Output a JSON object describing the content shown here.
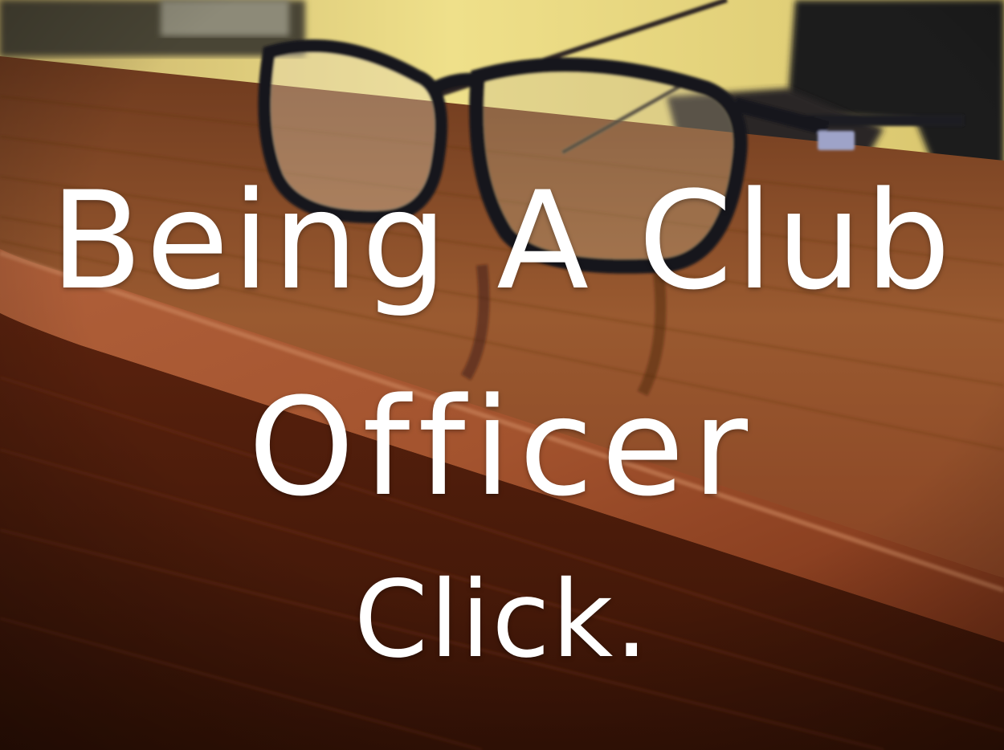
{
  "caption": {
    "line1": "Being A Club",
    "line2": "Officer",
    "line3": "Click."
  },
  "colors": {
    "text": "#ffffff",
    "wall": "#e8d77a",
    "wood": "#8a3e1c",
    "frame": "#14141c"
  }
}
